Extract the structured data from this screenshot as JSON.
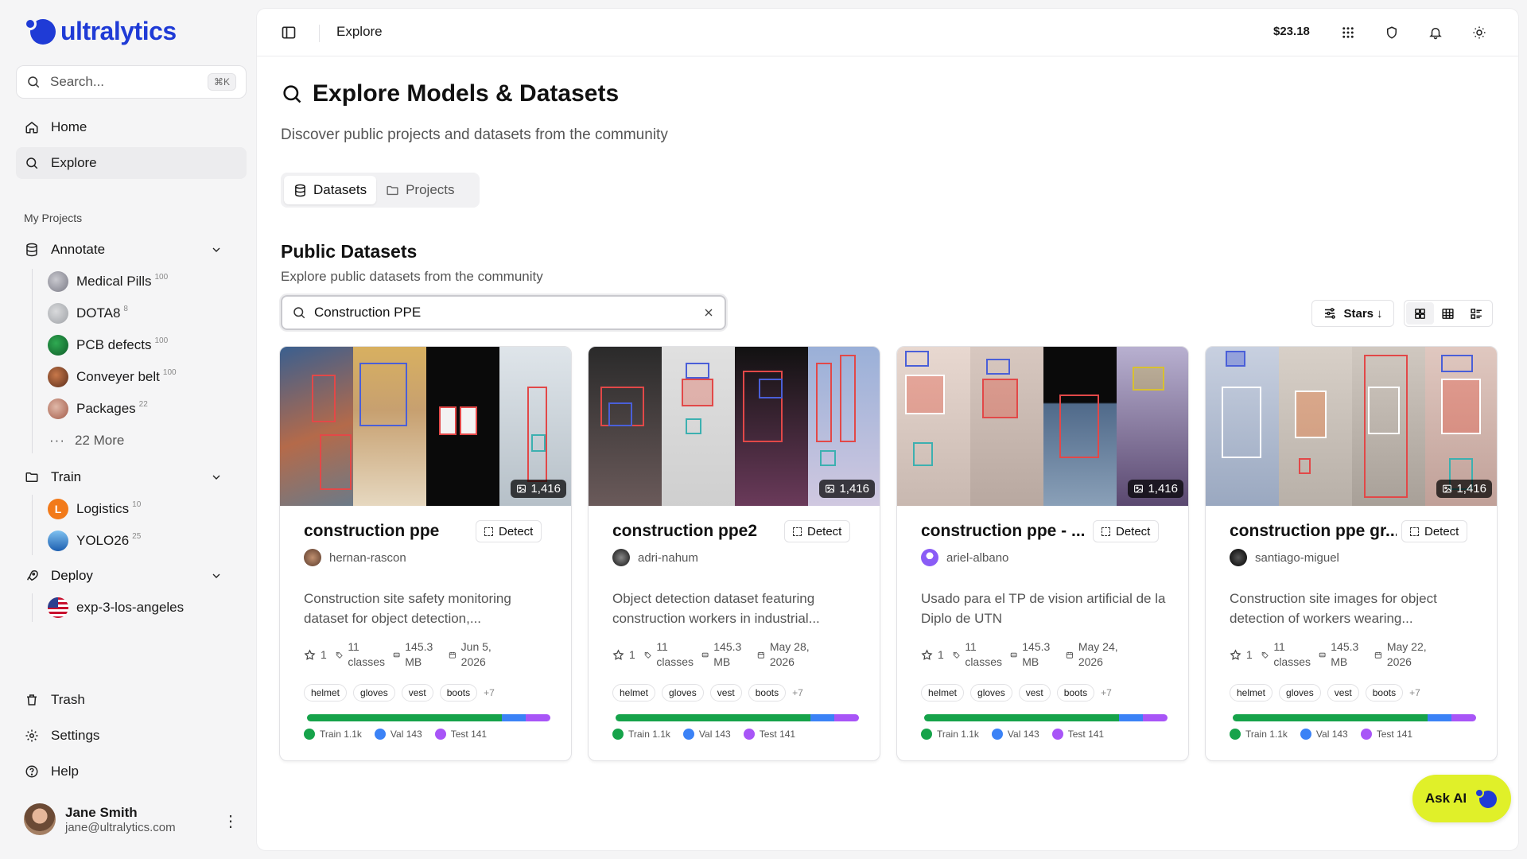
{
  "brand": {
    "name": "ultralytics",
    "color": "#1f3bd6"
  },
  "sidebar": {
    "search_placeholder": "Search...",
    "search_shortcut": "⌘K",
    "nav": [
      {
        "label": "Home",
        "icon": "home-icon"
      },
      {
        "label": "Explore",
        "icon": "search-icon",
        "active": true
      }
    ],
    "section_label": "My Projects",
    "annotate": {
      "label": "Annotate",
      "projects": [
        {
          "name": "Medical Pills",
          "count": "100"
        },
        {
          "name": "DOTA8",
          "count": "8"
        },
        {
          "name": "PCB defects",
          "count": "100"
        },
        {
          "name": "Conveyer belt",
          "count": "100"
        },
        {
          "name": "Packages",
          "count": "22"
        }
      ],
      "more": "22 More"
    },
    "train": {
      "label": "Train",
      "projects": [
        {
          "name": "Logistics",
          "count": "10",
          "initial": "L"
        },
        {
          "name": "YOLO26",
          "count": "25"
        }
      ]
    },
    "deploy": {
      "label": "Deploy",
      "projects": [
        {
          "name": "exp-3-los-angeles"
        }
      ]
    },
    "bottom": [
      {
        "label": "Trash"
      },
      {
        "label": "Settings"
      },
      {
        "label": "Help"
      }
    ],
    "user": {
      "name": "Jane Smith",
      "email": "jane@ultralytics.com"
    }
  },
  "topbar": {
    "breadcrumb": "Explore",
    "balance": "$23.18"
  },
  "page": {
    "title": "Explore Models & Datasets",
    "subtitle": "Discover public projects and datasets from the community",
    "tabs": [
      {
        "label": "Datasets",
        "active": true
      },
      {
        "label": "Projects"
      }
    ],
    "section_title": "Public Datasets",
    "section_subtitle": "Explore public datasets from the community",
    "filter_value": "Construction PPE",
    "sort_label": "Stars"
  },
  "split_colors": {
    "train": "#16a34a",
    "val": "#3b82f6",
    "test": "#a855f7"
  },
  "cards": [
    {
      "title": "construction ppe",
      "task": "Detect",
      "owner": "hernan-rascon",
      "image_count": "1,416",
      "description": "Construction site safety monitoring dataset for object detection,...",
      "stars": "1",
      "classes": "11 classes",
      "size": "145.3 MB",
      "date": "Jun 5, 2026",
      "tags": [
        "helmet",
        "gloves",
        "vest",
        "boots"
      ],
      "tags_more": "+7",
      "train": "Train 1.1k",
      "val": "Val 143",
      "test": "Test 141"
    },
    {
      "title": "construction ppe2",
      "task": "Detect",
      "owner": "adri-nahum",
      "image_count": "1,416",
      "description": "Object detection dataset featuring construction workers in industrial...",
      "stars": "1",
      "classes": "11 classes",
      "size": "145.3 MB",
      "date": "May 28, 2026",
      "tags": [
        "helmet",
        "gloves",
        "vest",
        "boots"
      ],
      "tags_more": "+7",
      "train": "Train 1.1k",
      "val": "Val 143",
      "test": "Test 141"
    },
    {
      "title": "construction ppe - ...",
      "task": "Detect",
      "owner": "ariel-albano",
      "image_count": "1,416",
      "description": "Usado para el TP de vision artificial de la Diplo de UTN",
      "stars": "1",
      "classes": "11 classes",
      "size": "145.3 MB",
      "date": "May 24, 2026",
      "tags": [
        "helmet",
        "gloves",
        "vest",
        "boots"
      ],
      "tags_more": "+7",
      "train": "Train 1.1k",
      "val": "Val 143",
      "test": "Test 141"
    },
    {
      "title": "construction ppe gr...",
      "task": "Detect",
      "owner": "santiago-miguel",
      "image_count": "1,416",
      "description": "Construction site images for object detection of workers wearing...",
      "stars": "1",
      "classes": "11 classes",
      "size": "145.3 MB",
      "date": "May 22, 2026",
      "tags": [
        "helmet",
        "gloves",
        "vest",
        "boots"
      ],
      "tags_more": "+7",
      "train": "Train 1.1k",
      "val": "Val 143",
      "test": "Test 141"
    }
  ],
  "ask_ai": "Ask AI"
}
